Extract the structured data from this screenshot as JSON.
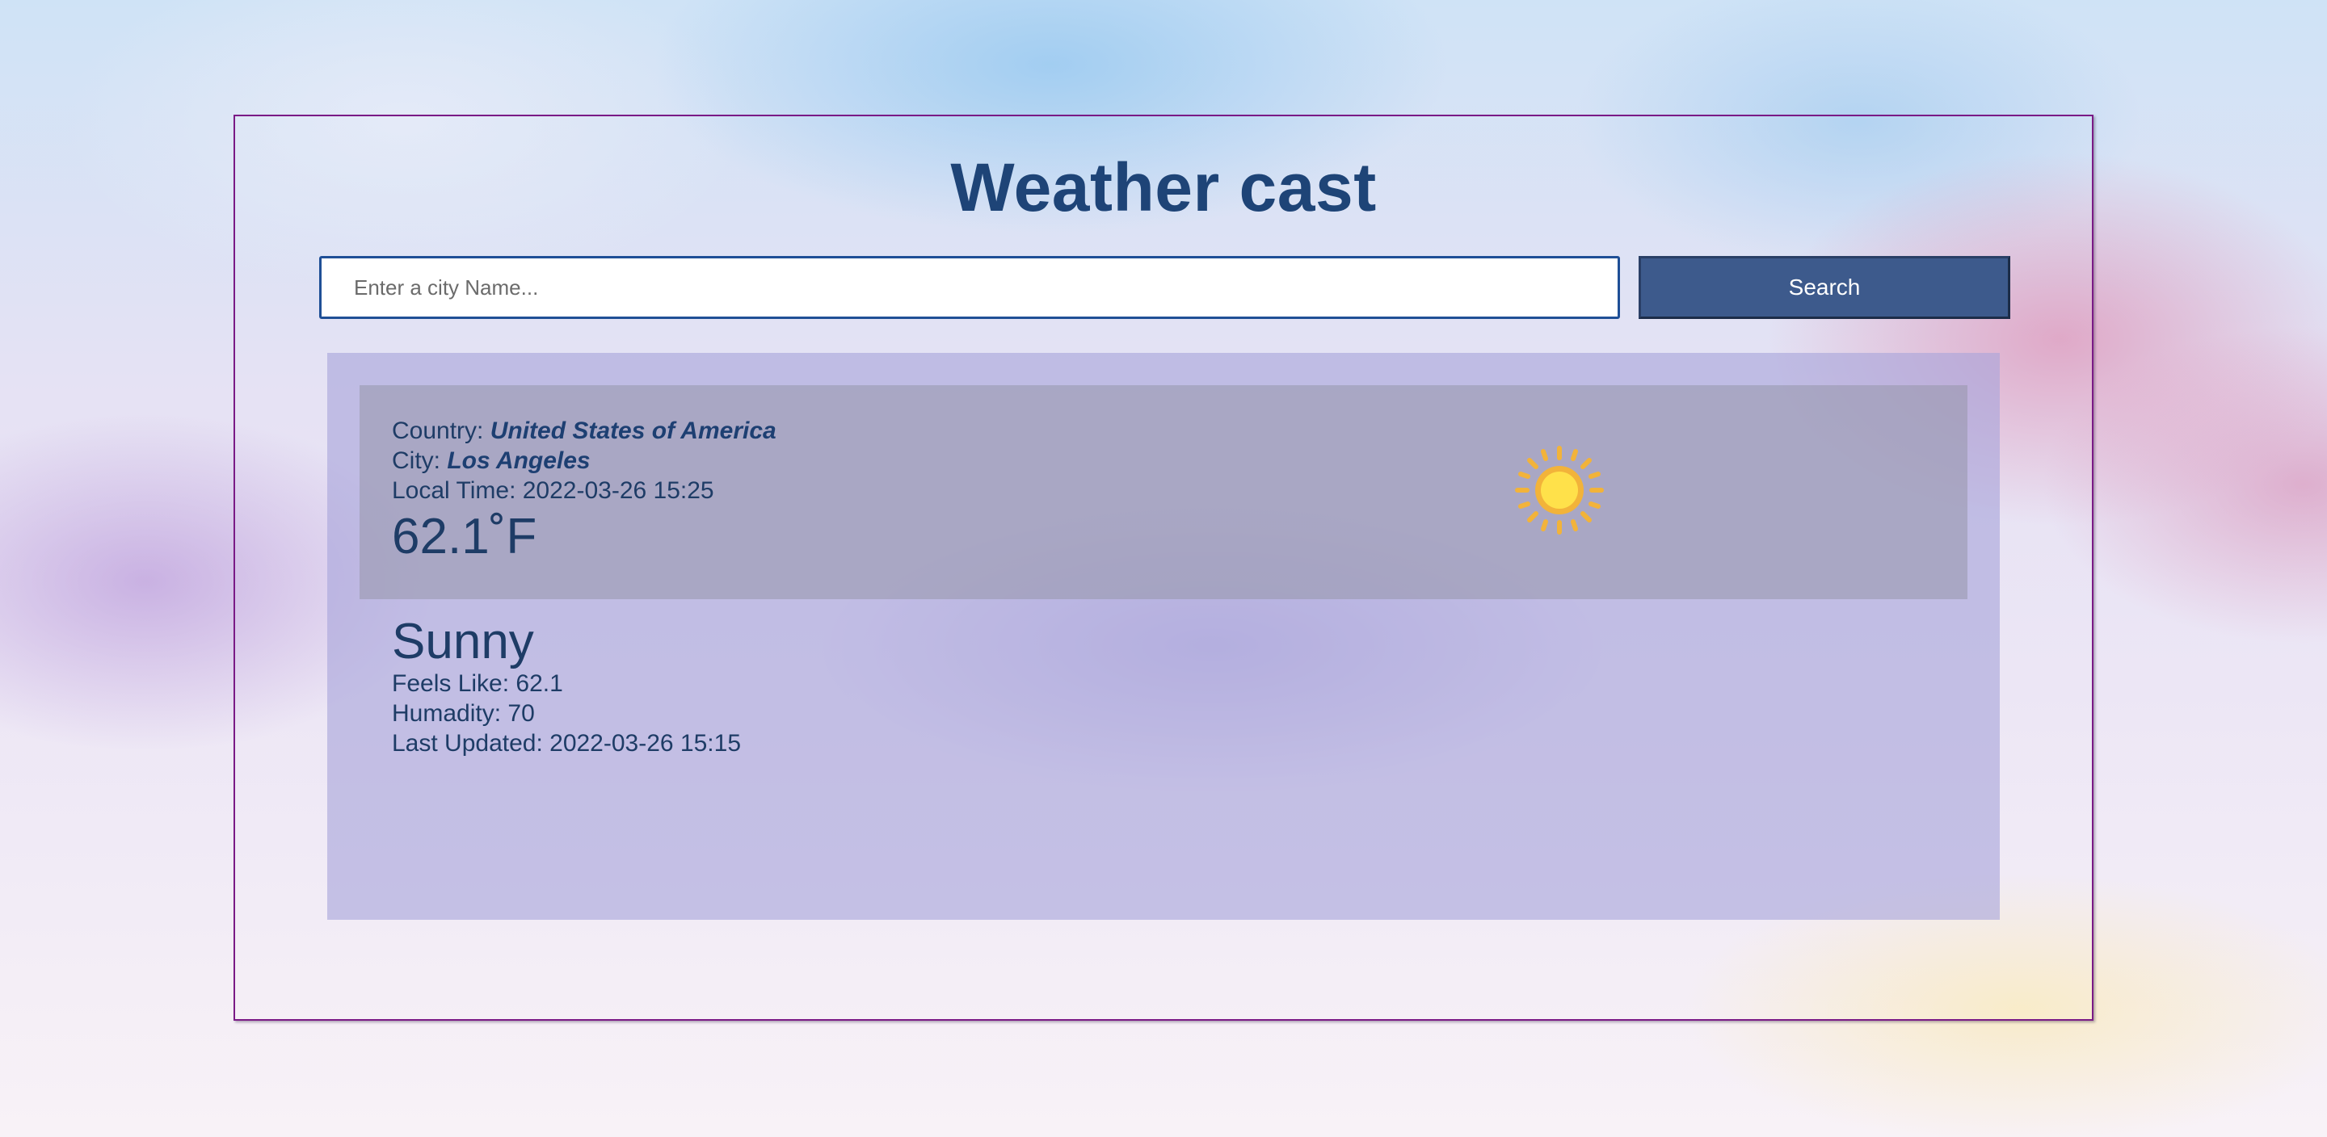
{
  "app": {
    "title": "Weather cast"
  },
  "search": {
    "placeholder": "Enter a city Name...",
    "value": "",
    "button_label": "Search"
  },
  "current": {
    "country_label": "Country: ",
    "country_value": "United States of America",
    "city_label": "City: ",
    "city_value": "Los Angeles",
    "local_time": "Local Time: 2022-03-26 15:25",
    "temperature": "62.1˚F",
    "icon": "sun-icon"
  },
  "details": {
    "condition": "Sunny",
    "feels_like": "Feels Like: 62.1",
    "humidity": "Humadity: 70",
    "last_updated": "Last Updated: 2022-03-26 15:15"
  },
  "colors": {
    "title": "#1e4477",
    "button_bg": "#3d5a8c",
    "frame_border": "#7a1a86",
    "text": "#1e3c66",
    "sun_core": "#ffe14a",
    "sun_rays": "#f2b33a"
  }
}
